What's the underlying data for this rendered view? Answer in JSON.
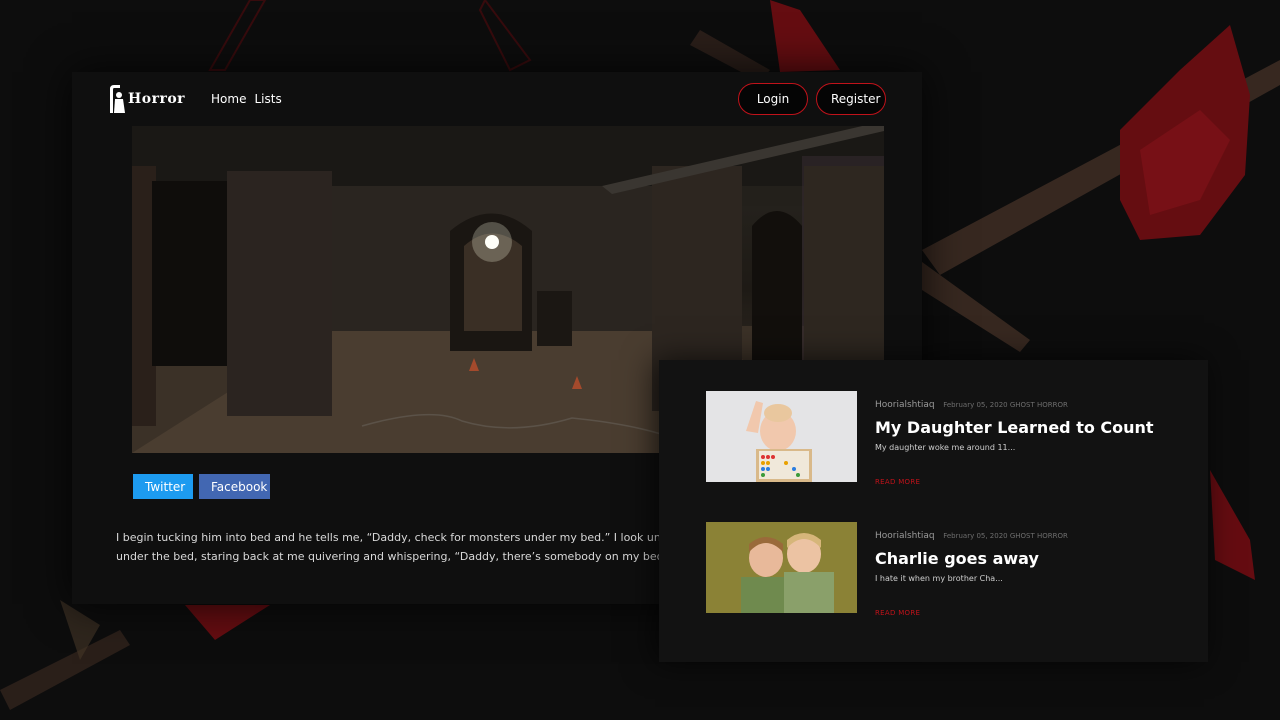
{
  "brand": {
    "logo_text": "Horror"
  },
  "nav": {
    "links": [
      {
        "label": "Home"
      },
      {
        "label": "Lists"
      }
    ],
    "login_label": "Login",
    "register_label": "Register"
  },
  "share": {
    "twitter_label": "Twitter",
    "facebook_label": "Facebook"
  },
  "story": {
    "line1": "I begin tucking him into bed and he tells me, “Daddy, check for monsters under my bed.” I look underneath",
    "line2": "under the bed, staring back at me quivering and whispering, “Daddy, there’s somebody on my bed."
  },
  "posts": [
    {
      "author": "Hoorialshtiaq",
      "date": "February 05, 2020 GHOST HORROR",
      "title": "My Daughter Learned to Count",
      "excerpt": "My daughter woke me around 11...",
      "read_more": "READ MORE"
    },
    {
      "author": "Hoorialshtiaq",
      "date": "February 05, 2020 GHOST HORROR",
      "title": "Charlie goes away",
      "excerpt": "I hate it when my brother Cha...",
      "read_more": "READ MORE"
    }
  ],
  "colors": {
    "accent": "#c0121a",
    "twitter": "#1d9bf0",
    "facebook": "#4267b2",
    "background": "#0d0d0d"
  },
  "icons": {
    "logo": "reaper-logo-icon"
  }
}
